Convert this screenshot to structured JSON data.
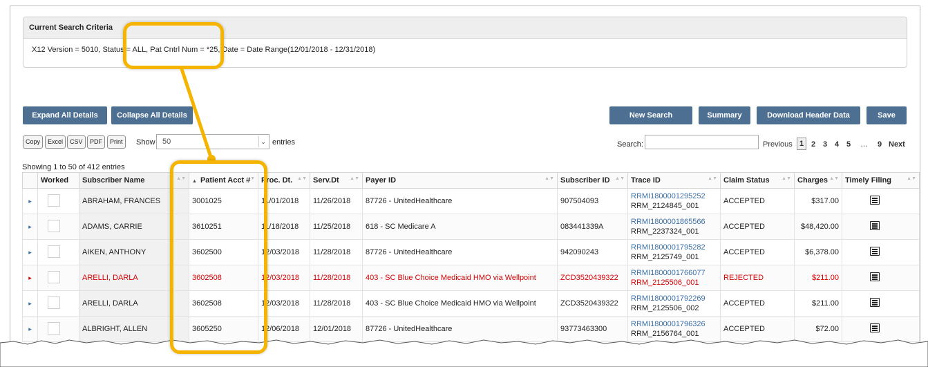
{
  "criteria": {
    "title": "Current Search Criteria",
    "text": "X12 Version = 5010, Status = ALL, Pat Cntrl Num = *25, Date = Date Range(12/01/2018 - 12/31/2018)"
  },
  "buttons": {
    "expand_all": "Expand All Details",
    "collapse_all": "Collapse All Details",
    "new_search": "New Search",
    "summary": "Summary",
    "download_header": "Download Header Data",
    "save": "Save"
  },
  "export": {
    "copy": "Copy",
    "excel": "Excel",
    "csv": "CSV",
    "pdf": "PDF",
    "print": "Print"
  },
  "entries": {
    "show_label": "Show",
    "selected": "50",
    "suffix": "entries",
    "search_label": "Search:",
    "info": "Showing 1 to 50 of 412 entries"
  },
  "pagination": {
    "previous": "Previous",
    "pages": [
      "1",
      "2",
      "3",
      "4",
      "5",
      "…",
      "9"
    ],
    "next": "Next",
    "active": "1"
  },
  "table": {
    "columns": [
      "Worked",
      "Subscriber Name",
      "Patient Acct #",
      "Proc. Dt.",
      "Serv.Dt",
      "Payer ID",
      "Subscriber ID",
      "Trace ID",
      "Claim Status",
      "Charges",
      "Timely Filing"
    ],
    "rows": [
      {
        "name": "ABRAHAM, FRANCES",
        "acct": "3001025",
        "proc": "11/01/2018",
        "serv": "11/26/2018",
        "payer": "87726 - UnitedHealthcare",
        "sub_id": "907504093",
        "trace": "RRMI1800001295252",
        "trace_sub": "RRM_2124845_001",
        "status": "ACCEPTED",
        "charges": "$317.00"
      },
      {
        "name": "ADAMS, CARRIE",
        "acct": "3610251",
        "proc": "11/18/2018",
        "serv": "11/25/2018",
        "payer": "618 - SC Medicare A",
        "sub_id": "083441339A",
        "trace": "RRMI1800001865566",
        "trace_sub": "RRM_2237324_001",
        "status": "ACCEPTED",
        "charges": "$48,420.00"
      },
      {
        "name": "AIKEN, ANTHONY",
        "acct": "3602500",
        "proc": "12/03/2018",
        "serv": "11/28/2018",
        "payer": "87726 - UnitedHealthcare",
        "sub_id": "942090243",
        "trace": "RRMI1800001795282",
        "trace_sub": "RRM_2125749_001",
        "status": "ACCEPTED",
        "charges": "$6,378.00"
      },
      {
        "name": "ARELLI, DARLA",
        "acct": "3602508",
        "proc": "12/03/2018",
        "serv": "11/28/2018",
        "payer": "403 - SC Blue Choice Medicaid HMO via Wellpoint",
        "sub_id": "ZCD3520439322",
        "trace": "RRMI1800001766077",
        "trace_sub": "RRM_2125506_001",
        "status": "REJECTED",
        "charges": "$211.00"
      },
      {
        "name": "ARELLI, DARLA",
        "acct": "3602508",
        "proc": "12/03/2018",
        "serv": "11/28/2018",
        "payer": "403 - SC Blue Choice Medicaid HMO via Wellpoint",
        "sub_id": "ZCD3520439322",
        "trace": "RRMI1800001792269",
        "trace_sub": "RRM_2125506_002",
        "status": "ACCEPTED",
        "charges": "$211.00"
      },
      {
        "name": "ALBRIGHT, ALLEN",
        "acct": "3605250",
        "proc": "12/06/2018",
        "serv": "12/01/2018",
        "payer": "87726 - UnitedHealthcare",
        "sub_id": "93773463300",
        "trace": "RRMI1800001796326",
        "trace_sub": "RRM_2156764_001",
        "status": "ACCEPTED",
        "charges": "$72.00"
      }
    ]
  },
  "colors": {
    "button": "#4d6f91",
    "link": "#3a6fa5",
    "rejected": "#d40000",
    "highlight": "#f4b400"
  }
}
